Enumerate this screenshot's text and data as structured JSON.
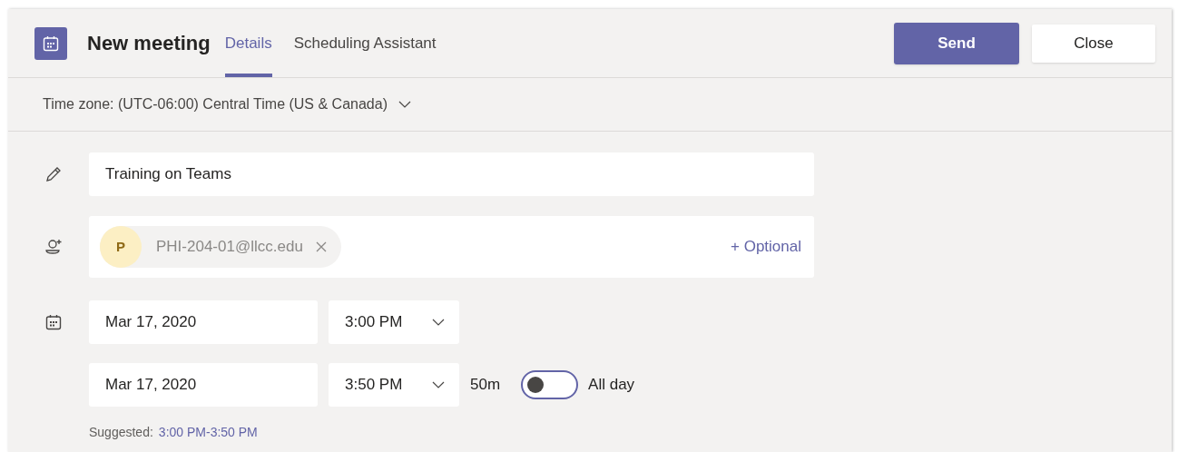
{
  "header": {
    "title": "New meeting",
    "tabs": [
      {
        "label": "Details",
        "selected": true
      },
      {
        "label": "Scheduling Assistant",
        "selected": false
      }
    ],
    "buttons": [
      {
        "label": "Send",
        "kind": "primary"
      },
      {
        "label": "Close",
        "kind": "secondary"
      }
    ]
  },
  "time_zone": {
    "label": "Time zone: (UTC-06:00) Central Time (US & Canada)"
  },
  "title_field": {
    "value": "Training on Teams"
  },
  "attendees": {
    "chips": [
      {
        "initial": "P",
        "email": "PHI-204-01@llcc.edu"
      }
    ],
    "optional_link": "+ Optional"
  },
  "start": {
    "date": "Mar 17, 2020",
    "time": "3:00 PM"
  },
  "end": {
    "date": "Mar 17, 2020",
    "time": "3:50 PM",
    "duration": "50m"
  },
  "all_day": {
    "label": "All day",
    "on": false
  },
  "suggested": {
    "label": "Suggested:",
    "value": "3:00 PM-3:50 PM"
  }
}
